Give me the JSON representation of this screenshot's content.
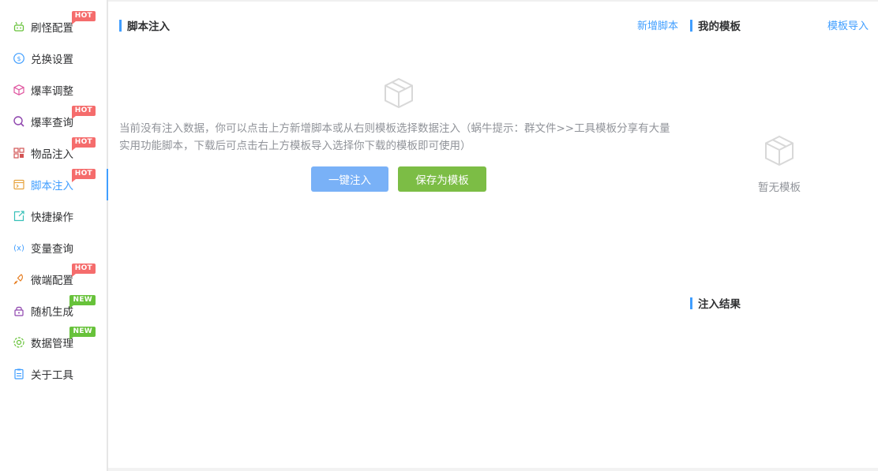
{
  "sidebar": {
    "items": [
      {
        "label": "刷怪配置",
        "icon": "android-robot-icon",
        "badge": "HOT",
        "color": "#67c23a"
      },
      {
        "label": "兑换设置",
        "icon": "dollar-circle-icon",
        "badge": "",
        "color": "#409eff"
      },
      {
        "label": "爆率调整",
        "icon": "cube-icon",
        "badge": "",
        "color": "#e056a0"
      },
      {
        "label": "爆率查询",
        "icon": "search-icon",
        "badge": "HOT",
        "color": "#8e44ad"
      },
      {
        "label": "物品注入",
        "icon": "grid-icon",
        "badge": "HOT",
        "color": "#e6a23c"
      },
      {
        "label": "脚本注入",
        "icon": "terminal-icon",
        "badge": "HOT",
        "color": "#e6a23c"
      },
      {
        "label": "快捷操作",
        "icon": "external-link-icon",
        "badge": "",
        "color": "#36c0b8"
      },
      {
        "label": "变量查询",
        "icon": "variable-icon",
        "badge": "",
        "color": "#409eff"
      },
      {
        "label": "微端配置",
        "icon": "rocket-icon",
        "badge": "HOT",
        "color": "#e67e22"
      },
      {
        "label": "随机生成",
        "icon": "lock-icon",
        "badge": "NEW",
        "color": "#8e44ad"
      },
      {
        "label": "数据管理",
        "icon": "settings-ring-icon",
        "badge": "NEW",
        "color": "#67c23a"
      },
      {
        "label": "关于工具",
        "icon": "document-icon",
        "badge": "",
        "color": "#409eff"
      }
    ],
    "active_index": 5
  },
  "script_panel": {
    "title": "脚本注入",
    "add_link": "新增脚本",
    "empty_text": "当前没有注入数据，你可以点击上方新增脚本或从右则模板选择数据注入（蜗牛提示：群文件>>工具模板分享有大量实用功能脚本，下载后可点击右上方模板导入选择你下载的模板即可使用）",
    "inject_button": "一键注入",
    "save_button": "保存为模板"
  },
  "template_panel": {
    "title": "我的模板",
    "import_link": "模板导入",
    "empty_text": "暂无模板"
  },
  "result_panel": {
    "title": "注入结果"
  },
  "colors": {
    "accent": "#409eff",
    "primary_button": "#79b1f7",
    "success_button": "#7cbd45",
    "hot_badge": "#f56c6c",
    "new_badge": "#67c23a"
  }
}
